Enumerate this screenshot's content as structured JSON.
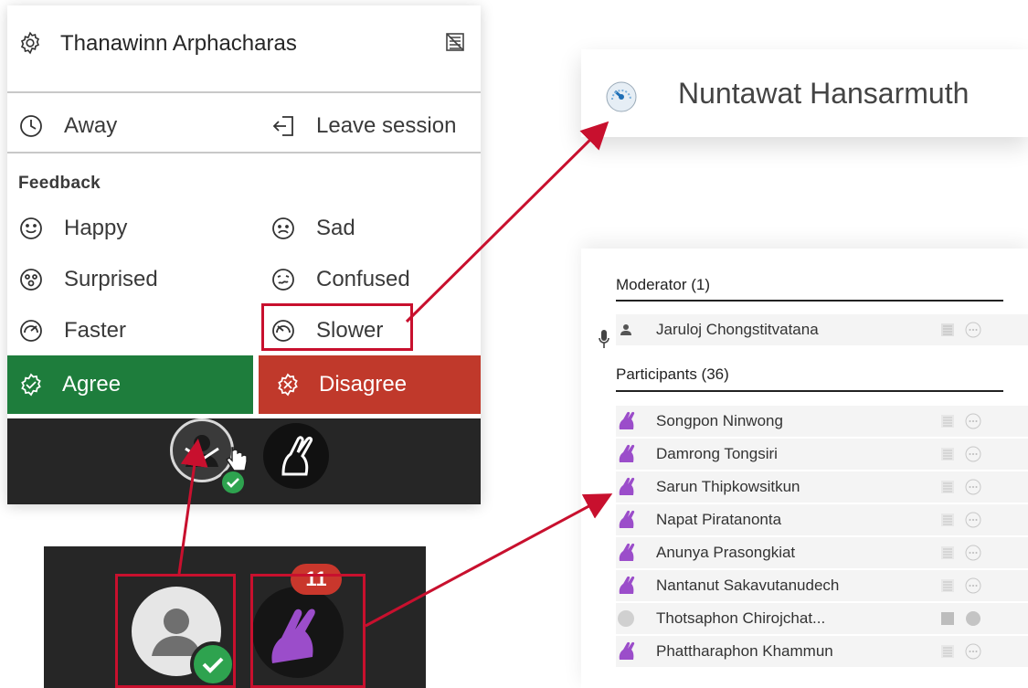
{
  "menu": {
    "user_name": "Thanawinn Arphacharas",
    "away_label": "Away",
    "leave_label": "Leave session",
    "feedback_title": "Feedback",
    "feedback": {
      "happy": "Happy",
      "sad": "Sad",
      "surprised": "Surprised",
      "confused": "Confused",
      "faster": "Faster",
      "slower": "Slower",
      "agree": "Agree",
      "disagree": "Disagree"
    }
  },
  "user_card": {
    "name": "Nuntawat Hansarmuth"
  },
  "panel": {
    "moderator_title": "Moderator (1)",
    "moderator_name": "Jaruloj Chongstitvatana",
    "participants_title": "Participants (36)",
    "participants": [
      "Songpon Ninwong",
      "Damrong Tongsiri",
      "Sarun Thipkowsitkun",
      "Napat Piratanonta",
      "Anunya Prasongkiat",
      "Nantanut Sakavutanudech",
      "Thotsaphon Chirojchat...",
      "Phattharaphon Khammun"
    ]
  },
  "dock": {
    "hand_count": "11"
  },
  "colors": {
    "agree": "#1e7d3c",
    "disagree": "#c0392b",
    "highlight": "#c8102e",
    "hand": "#9b4dca",
    "toolbar": "#262626"
  }
}
